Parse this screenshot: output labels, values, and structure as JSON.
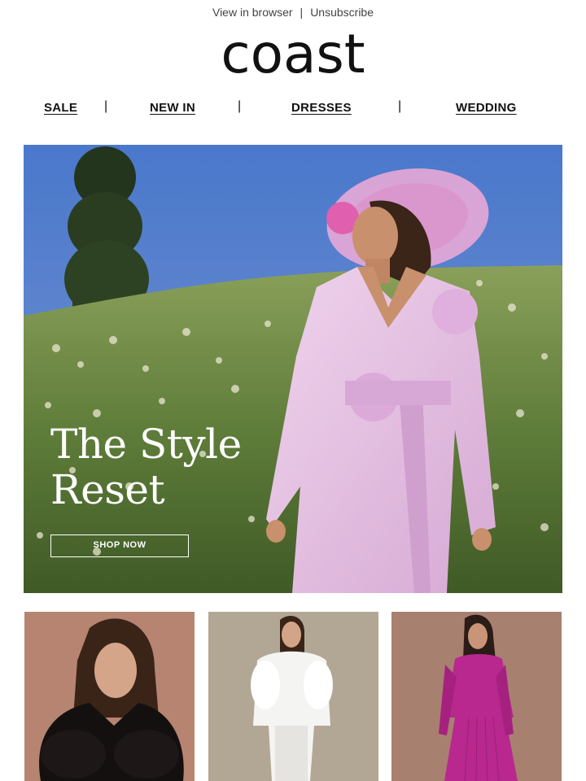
{
  "header": {
    "view_in_browser": "View in browser",
    "separator": "|",
    "unsubscribe": "Unsubscribe"
  },
  "brand": {
    "logo_text": "coast"
  },
  "nav": {
    "items": [
      {
        "label": "SALE"
      },
      {
        "label": "NEW IN"
      },
      {
        "label": "DRESSES"
      },
      {
        "label": "WEDDING"
      }
    ],
    "separator": "|"
  },
  "hero": {
    "title_line1": "The Style",
    "title_line2": "Reset",
    "cta_label": "SHOP NOW"
  },
  "products": [
    {
      "name": "faux fur coat look"
    },
    {
      "name": "white bridal faux fur look"
    },
    {
      "name": "magenta pleated dress look"
    }
  ],
  "colors": {
    "text": "#111111",
    "sky": "#5a82cf",
    "hedge": "#5d7a3e",
    "suit_pink": "#e4bfe0",
    "magenta": "#b8288f"
  }
}
